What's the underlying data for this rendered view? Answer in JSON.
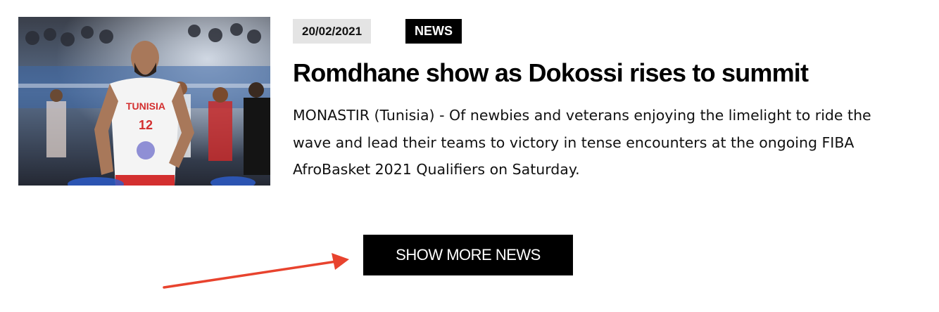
{
  "article": {
    "date": "20/02/2021",
    "category": "NEWS",
    "headline": "Romdhane show as Dokossi rises to summit",
    "excerpt": "MONASTIR (Tunisia) - Of newbies and veterans enjoying the limelight to ride the wave and lead their teams to victory in tense encounters at the ongoing FIBA AfroBasket 2021 Qualifiers on Saturday.",
    "image": {
      "jersey_text": "TUNISIA",
      "jersey_number": "12"
    }
  },
  "actions": {
    "show_more_label": "SHOW MORE NEWS"
  },
  "colors": {
    "badge_dark": "#000000",
    "badge_light": "#e4e4e4",
    "annotation_arrow": "#e8432e"
  }
}
